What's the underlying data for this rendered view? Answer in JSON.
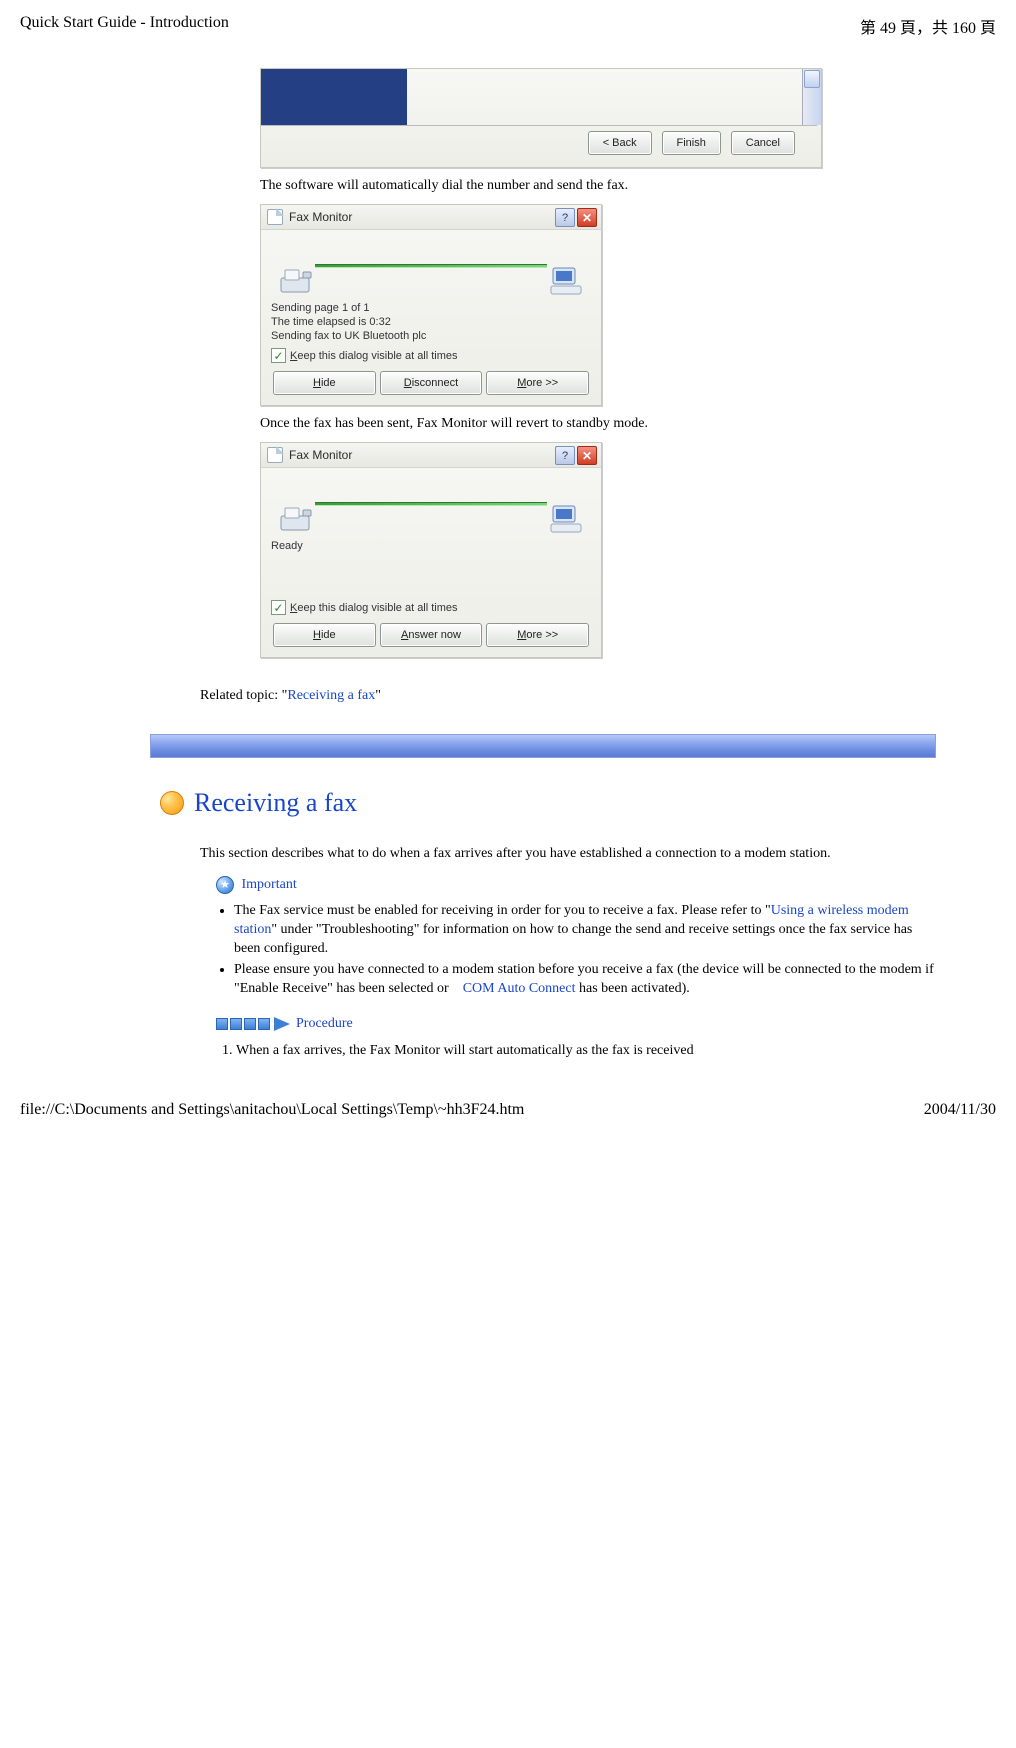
{
  "header": {
    "title_left": "Quick Start Guide - Introduction",
    "page_indicator": "第 49 頁，共 160 頁"
  },
  "footer": {
    "path": "file://C:\\Documents and Settings\\anitachou\\Local Settings\\Temp\\~hh3F24.htm",
    "date": "2004/11/30"
  },
  "wizard": {
    "back_label": "< Back",
    "finish_label": "Finish",
    "cancel_label": "Cancel"
  },
  "body_texts": {
    "after_wizard": "The software will automatically dial the number and send the fax.",
    "after_sending": "Once the fax has been sent, Fax Monitor will revert to standby mode.",
    "related_prefix": "Related topic: \"",
    "related_link": "Receiving a fax",
    "related_suffix": "\""
  },
  "fax_monitor_sending": {
    "title": "Fax Monitor",
    "line1": "Sending page 1 of 1",
    "line2": "The time elapsed is 0:32",
    "line3": "Sending fax to UK Bluetooth plc",
    "keep_visible": "Keep this dialog visible at all times",
    "hide": "Hide",
    "disconnect": "Disconnect",
    "more": "More >>"
  },
  "fax_monitor_ready": {
    "title": "Fax Monitor",
    "status": "Ready",
    "keep_visible": "Keep this dialog visible at all times",
    "hide": "Hide",
    "answer": "Answer now",
    "more": "More >>"
  },
  "section": {
    "heading": "Receiving a fax",
    "intro": "This section describes what to do when a fax arrives after you have established a connection to a modem station.",
    "important_label": "Important",
    "bullet1_pre": "The Fax service must be enabled for receiving in order for you to receive a fax. Please refer to \"",
    "bullet1_link": "Using a wireless modem station",
    "bullet1_post": "\" under \"Troubleshooting\" for information on how to change the send and receive settings once the fax service has been configured.",
    "bullet2_pre": "Please ensure you have connected to a modem station before you receive a fax (the device will be connected to the modem if \"Enable Receive\" has been selected or　",
    "bullet2_link": "COM Auto Connect",
    "bullet2_post": " has been activated).",
    "procedure_label": "Procedure",
    "step1": "When a fax arrives, the Fax Monitor will start automatically as the fax is received"
  }
}
